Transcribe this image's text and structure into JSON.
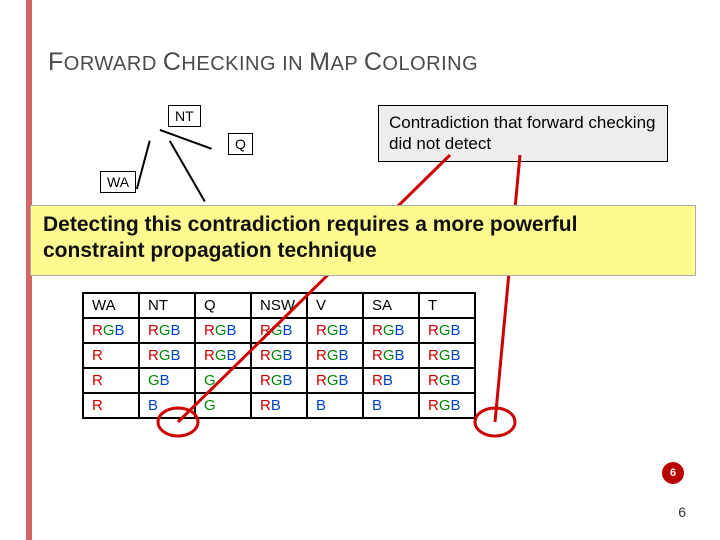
{
  "title_parts": {
    "p1": "F",
    "p2": "ORWARD ",
    "p3": "C",
    "p4": "HECKING IN ",
    "p5": "M",
    "p6": "AP ",
    "p7": "C",
    "p8": "OLORING"
  },
  "map": {
    "nt": "NT",
    "q": "Q",
    "wa": "WA"
  },
  "callout": "Contradiction that forward checking did not detect",
  "yellow_note": "Detecting this contradiction requires a more powerful constraint propagation technique",
  "table": {
    "headers": [
      "WA",
      "NT",
      "Q",
      "NSW",
      "V",
      "SA",
      "T"
    ],
    "rows": [
      [
        "RGB",
        "RGB",
        "RGB",
        "RGB",
        "RGB",
        "RGB",
        "RGB"
      ],
      [
        "R",
        "RGB",
        "RGB",
        "RGB",
        "RGB",
        "RGB",
        "RGB"
      ],
      [
        "R",
        "GB",
        "G",
        "RGB",
        "RGB",
        "RB",
        "RGB"
      ],
      [
        "R",
        "B",
        "G",
        "RB",
        "B",
        "B",
        "RGB"
      ]
    ]
  },
  "slide_number_badge": "6",
  "slide_number_footer": "6"
}
